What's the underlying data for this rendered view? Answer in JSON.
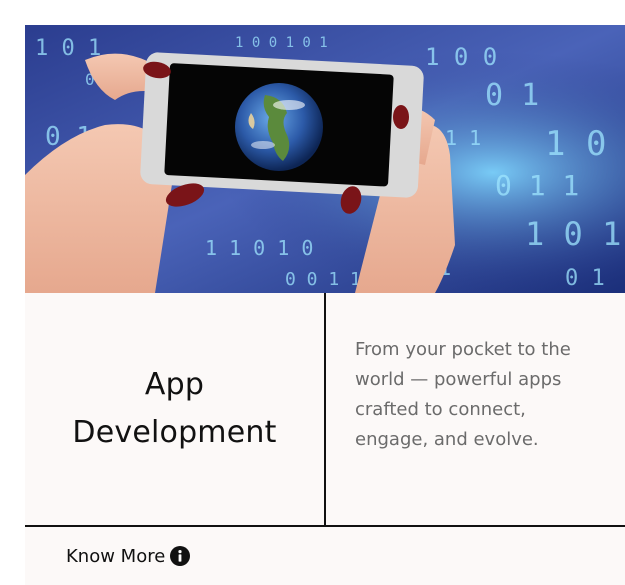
{
  "card": {
    "image": {
      "alt": "",
      "icon": "hands-holding-phone-earth-image"
    },
    "title_line1": "App",
    "title_line2": "Development",
    "description": "From your pocket to the world — powerful apps crafted to connect, engage, and evolve.",
    "cta_label": "Know More",
    "cta_icon": "info-icon"
  },
  "colors": {
    "background": "#fcf9f8",
    "text_dark": "#111111",
    "text_muted": "#6b6b6b",
    "divider": "#111111"
  }
}
